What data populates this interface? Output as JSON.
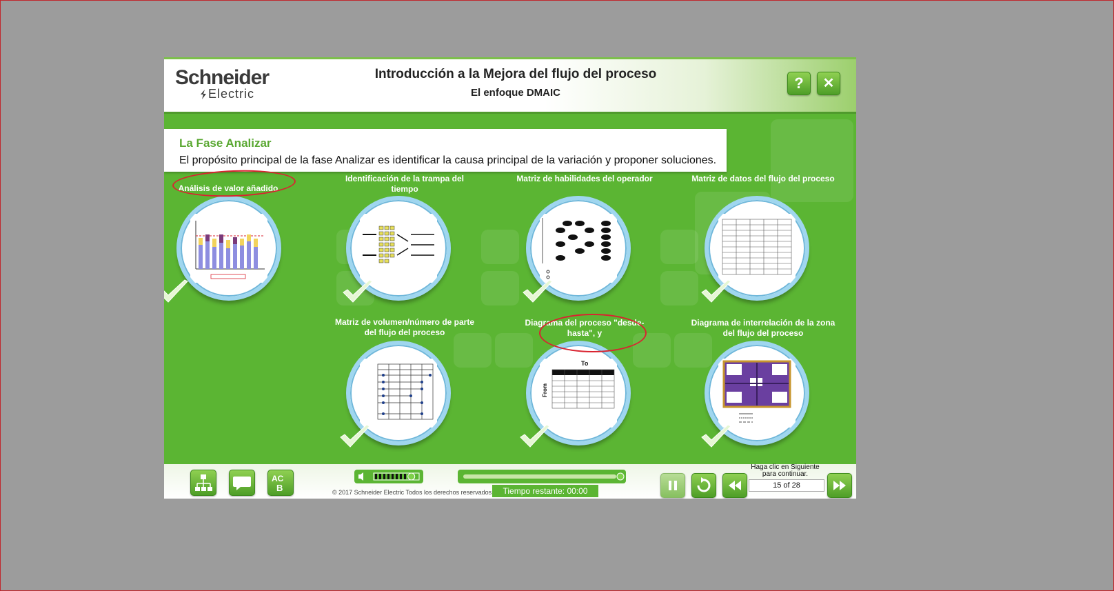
{
  "header": {
    "logo_line1": "Schneider",
    "logo_line2": "Electric",
    "title": "Introducción a la Mejora del flujo del proceso",
    "subtitle": "El enfoque DMAIC",
    "help_label": "?",
    "close_label": "✕"
  },
  "intro": {
    "title": "La Fase Analizar",
    "text": "El propósito principal de la fase Analizar es identificar la causa principal de la variación y proponer soluciones."
  },
  "items": [
    {
      "label": "Análisis de valor añadido",
      "icon": "bar-chart-thumbnail",
      "completed": true
    },
    {
      "label": "Identificación de la trampa del tiempo",
      "icon": "flow-diagram-thumbnail",
      "completed": true
    },
    {
      "label": "Matriz de habilidades del operador",
      "icon": "skills-matrix-thumbnail",
      "completed": true
    },
    {
      "label": "Matriz de datos del flujo del proceso",
      "icon": "data-table-thumbnail",
      "completed": true
    },
    {
      "label": "Matriz de volumen/número de parte del flujo del proceso",
      "icon": "volume-matrix-thumbnail",
      "completed": true
    },
    {
      "label": "Diagrama del proceso \"desde-hasta\", y",
      "icon": "from-to-table-thumbnail",
      "completed": true
    },
    {
      "label": "Diagrama de interrelación de la zona del flujo del proceso",
      "icon": "zone-map-thumbnail",
      "completed": true
    }
  ],
  "bottom": {
    "copyright": "© 2017 Schneider Electric Todos los derechos reservados.",
    "time_label": "Tiempo restante:",
    "time_value": "00:00",
    "hint": "Haga clic en Siguiente para continuar.",
    "page": "15 of 28",
    "volume_level": 0.85,
    "progress": 1.0
  },
  "colors": {
    "brand_green": "#5bb533",
    "accent_red": "#d92330",
    "ring_blue": "#9fd6ef"
  }
}
